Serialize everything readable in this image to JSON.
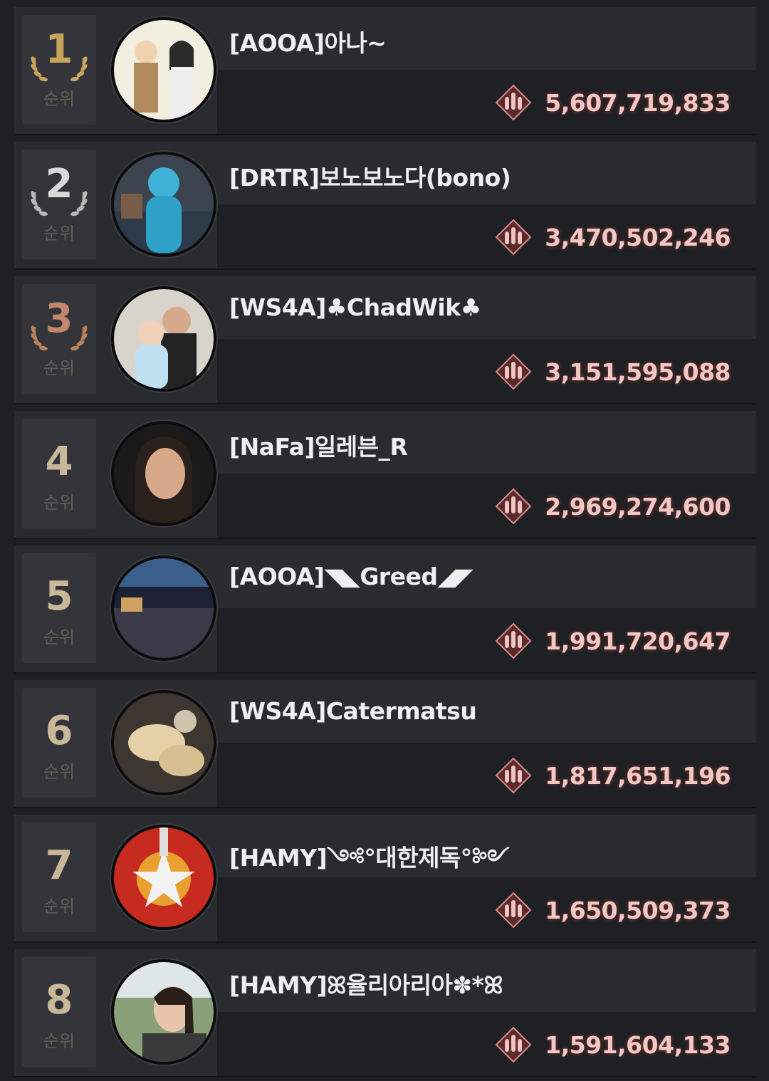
{
  "colors": {
    "gold": "#c9a45c",
    "silver": "#b8b8b8",
    "bronze": "#b9805a",
    "rank_number": "#c9b799",
    "score_text": "#f3c8c4"
  },
  "icons": {
    "score": "bullets-emblem-icon",
    "laurel": "laurel-wreath-icon"
  },
  "leaderboard": [
    {
      "rank": "1",
      "rank_label": "순위",
      "medal": "gold",
      "name": "[AOOA]아나~",
      "score": "5,607,719,833",
      "avatar": "cartoon-couple-avatar"
    },
    {
      "rank": "2",
      "rank_label": "순위",
      "medal": "silver",
      "name": "[DRTR]보노보노다(bono)",
      "score": "3,470,502,246",
      "avatar": "blue-mascot-avatar"
    },
    {
      "rank": "3",
      "rank_label": "순위",
      "medal": "bronze",
      "name": "[WS4A]♣ChadWik♣",
      "score": "3,151,595,088",
      "avatar": "father-daughter-avatar"
    },
    {
      "rank": "4",
      "rank_label": "순위",
      "medal": "",
      "name": "[NaFa]일레븐_R",
      "score": "2,969,274,600",
      "avatar": "woman-portrait-avatar"
    },
    {
      "rank": "5",
      "rank_label": "순위",
      "medal": "",
      "name": "[AOOA]◥◣Greed◢◤",
      "score": "1,991,720,647",
      "avatar": "night-terrace-avatar"
    },
    {
      "rank": "6",
      "rank_label": "순위",
      "medal": "",
      "name": "[WS4A]Catermatsu",
      "score": "1,817,651,196",
      "avatar": "dogs-avatar"
    },
    {
      "rank": "7",
      "rank_label": "순위",
      "medal": "",
      "name": "[HAMY]༺°대한제독°༻",
      "score": "1,650,509,373",
      "avatar": "military-emblem-avatar"
    },
    {
      "rank": "8",
      "rank_label": "순위",
      "medal": "",
      "name": "[HAMY]ꕤ율리아리아✽*ꕤ",
      "score": "1,591,604,133",
      "avatar": "woman-selfie-avatar"
    }
  ]
}
